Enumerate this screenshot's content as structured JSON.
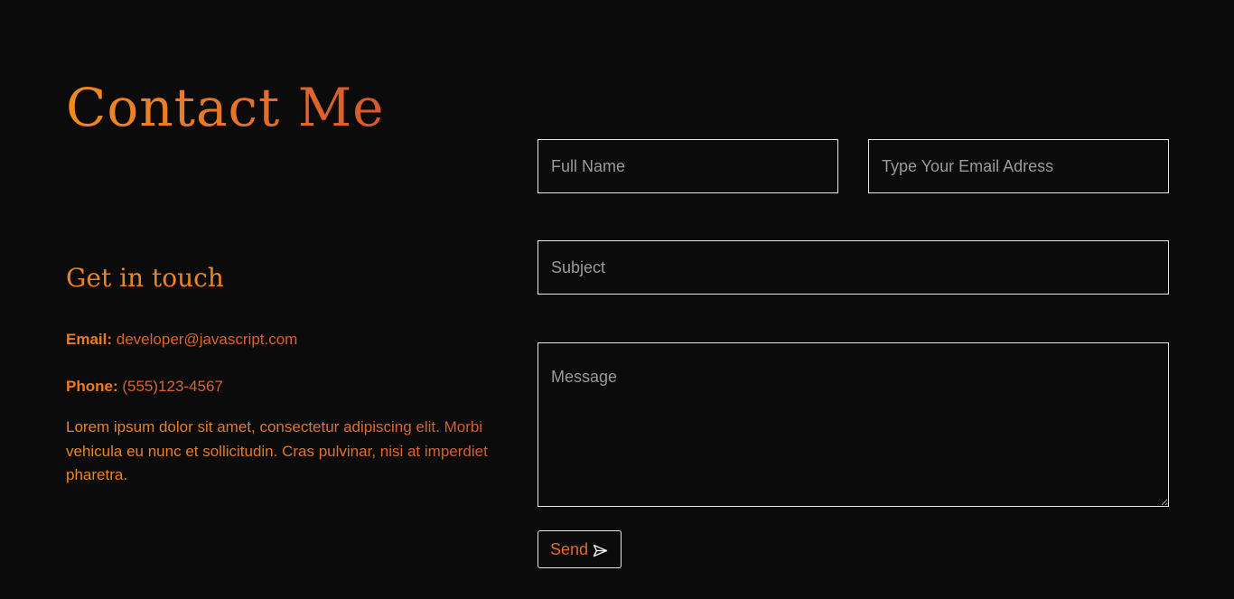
{
  "page": {
    "title": "Contact Me",
    "subtitle": "Get in touch"
  },
  "contact": {
    "email_label": "Email:",
    "email_value": "developer@javascript.com",
    "phone_label": "Phone:",
    "phone_value": "(555)123-4567",
    "description": "Lorem ipsum dolor sit amet, consectetur adipiscing elit. Morbi vehicula eu nunc et sollicitudin. Cras pulvinar, nisi at imperdiet pharetra."
  },
  "form": {
    "name_placeholder": "Full Name",
    "email_placeholder": "Type Your Email Adress",
    "subject_placeholder": "Subject",
    "message_placeholder": "Message",
    "send_label": "Send",
    "send_icon": "paper-plane-icon"
  },
  "colors": {
    "background": "#0b0b0b",
    "accent_orange": "#f08a1c",
    "accent_red_orange": "#d9632d",
    "border": "#e8e8e8",
    "placeholder": "#9a9a9a"
  }
}
